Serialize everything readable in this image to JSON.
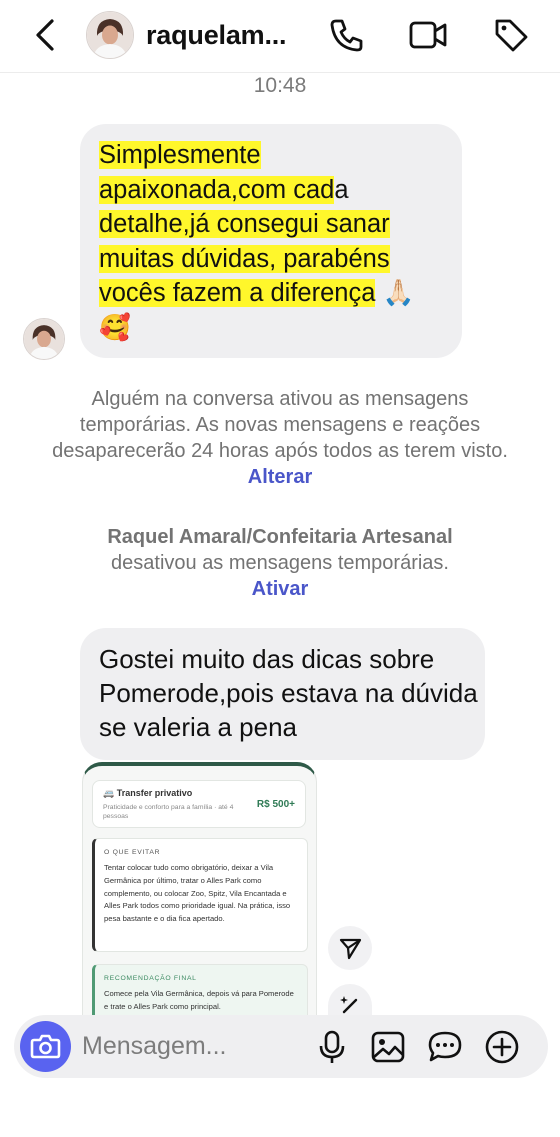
{
  "header": {
    "username": "raquelam...",
    "icons": [
      "back-chevron-icon",
      "phone-icon",
      "video-camera-icon",
      "tag-icon"
    ]
  },
  "chat": {
    "timestamp": "10:48",
    "message1": {
      "lines": [
        "Simplesmente",
        "apaixonada,com cad",
        "a",
        "detalhe,já consegui sanar",
        "muitas dúvidas, parabéns",
        "vocês fazem a diferença",
        "🙏🏻",
        "🥰"
      ]
    },
    "notice1": {
      "text": "Alguém na conversa ativou as mensagens temporárias. As novas mensagens e reações desaparecerão 24 horas após todos as terem visto.",
      "link": "Alterar"
    },
    "notice2": {
      "name": "Raquel Amaral/Confeitaria Artesanal",
      "text": "desativou as mensagens temporárias.",
      "link": "Ativar"
    },
    "message2": {
      "text": "Gostei muito das dicas sobre Pomerode,pois estava na dúvida se valeria a pena"
    },
    "attachment": {
      "card1": {
        "title": "🚐 Transfer privativo",
        "subtitle": "Praticidade e conforto para a família · até 4 pessoas",
        "price": "R$ 500+"
      },
      "card2": {
        "label": "O QUE EVITAR",
        "text": "Tentar colocar tudo como obrigatório, deixar a Vila Germânica por último, tratar o Alles Park como complemento, ou colocar Zoo, Spitz, Vila Encantada e Alles Park todos como prioridade igual. Na prática, isso pesa bastante e o dia fica apertado."
      },
      "card3": {
        "label": "RECOMENDAÇÃO FINAL",
        "text": "Comece pela Vila Germânica, depois vá para Pomerode e trate o Alles Park como principal."
      }
    }
  },
  "composer": {
    "placeholder": "Mensagem...",
    "icons": [
      "camera-icon",
      "microphone-icon",
      "image-icon",
      "chat-bubble-icon",
      "plus-icon"
    ]
  },
  "colors": {
    "highlight": "#fff72b",
    "link": "#4a56c9",
    "camera_button": "#5963f0",
    "bubble": "#efeff1"
  }
}
